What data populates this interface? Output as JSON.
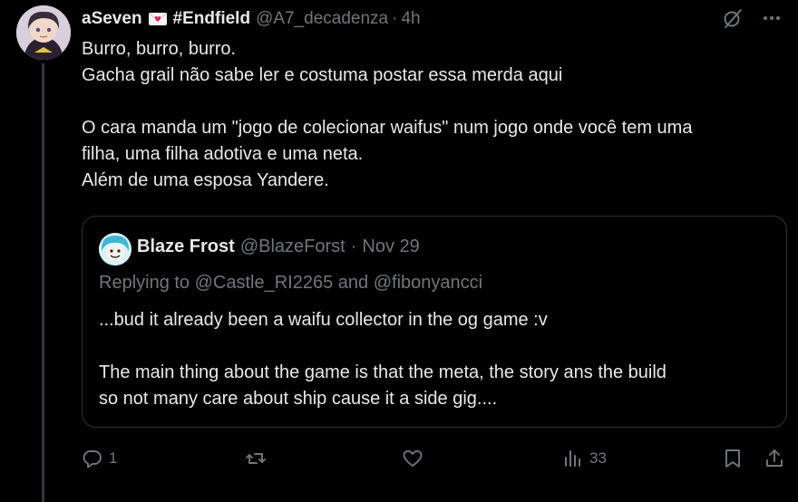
{
  "post": {
    "display_name": "aSeven",
    "name_suffix": "#Endfield",
    "handle": "@A7_decadenza",
    "separator": "·",
    "time": "4h",
    "text_lines": [
      "Burro, burro, burro.",
      "Gacha grail não sabe ler e costuma postar essa merda aqui",
      "",
      "O cara manda um \"jogo de colecionar waifus\" num jogo onde você tem uma",
      "filha, uma filha adotiva e uma neta.",
      "Além de uma esposa Yandere."
    ]
  },
  "quote": {
    "display_name": "Blaze Frost",
    "handle": "@BlazeForst",
    "separator": "·",
    "time": "Nov 29",
    "replying_to": "Replying to @Castle_RI2265 and @fibonyancci",
    "text_lines": [
      "...bud it already been a waifu collector in the og game :v",
      "",
      "The main thing about the game is that the meta, the story ans the build",
      "so not many care about ship cause it a side gig...."
    ]
  },
  "actions": {
    "reply_count": "1",
    "repost_count": "",
    "like_count": "",
    "views_count": "33"
  },
  "icons": {
    "top_right": [
      "grok-icon",
      "more-icon"
    ],
    "action_bar": [
      "reply-icon",
      "repost-icon",
      "like-icon",
      "views-icon",
      "bookmark-icon",
      "share-icon"
    ],
    "name_emoji": "love-letter-icon"
  },
  "colors": {
    "background": "#000000",
    "text": "#e7e9ea",
    "muted": "#71767b",
    "border": "#2f3336"
  }
}
